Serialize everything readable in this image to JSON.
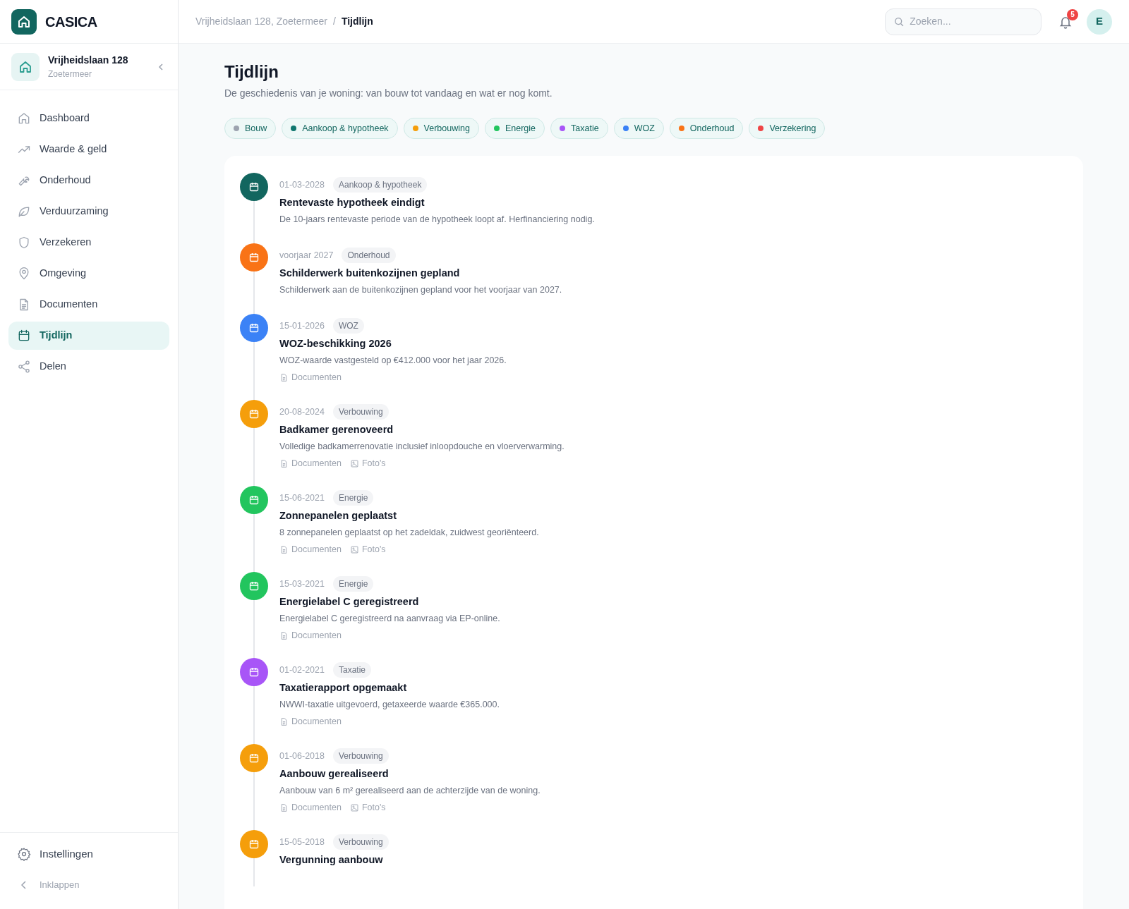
{
  "brand": {
    "name": "CASICA"
  },
  "property": {
    "street": "Vrijheidslaan 128",
    "city": "Zoetermeer"
  },
  "nav": [
    {
      "label": "Dashboard",
      "selected": false
    },
    {
      "label": "Waarde & geld",
      "selected": false
    },
    {
      "label": "Onderhoud",
      "selected": false
    },
    {
      "label": "Verduurzaming",
      "selected": false
    },
    {
      "label": "Verzekeren",
      "selected": false
    },
    {
      "label": "Omgeving",
      "selected": false
    },
    {
      "label": "Documenten",
      "selected": false
    },
    {
      "label": "Tijdlijn",
      "selected": true
    },
    {
      "label": "Delen",
      "selected": false
    }
  ],
  "sidebar_footer": {
    "settings": "Instellingen",
    "collapse": "Inklappen"
  },
  "breadcrumb": [
    "Vrijheidslaan 128, Zoetermeer",
    "Tijdlijn"
  ],
  "breadcrumb_separator": "/",
  "search": {
    "placeholder": "Zoeken..."
  },
  "notifications": {
    "count": "5"
  },
  "avatar": {
    "initial": "E"
  },
  "page": {
    "title": "Tijdlijn",
    "subtitle": "De geschiedenis van je woning: van bouw tot vandaag en wat er nog komt."
  },
  "filters": [
    {
      "label": "Bouw",
      "color": "#9ca3af"
    },
    {
      "label": "Aankoop & hypotheek",
      "color": "#0f766e"
    },
    {
      "label": "Verbouwing",
      "color": "#f59e0b"
    },
    {
      "label": "Energie",
      "color": "#22c55e"
    },
    {
      "label": "Taxatie",
      "color": "#a855f7"
    },
    {
      "label": "WOZ",
      "color": "#3b82f6"
    },
    {
      "label": "Onderhoud",
      "color": "#f97316"
    },
    {
      "label": "Verzekering",
      "color": "#ef4444"
    }
  ],
  "events": [
    {
      "date": "01-03-2028",
      "category": "Aankoop & hypotheek",
      "color": "#12665f",
      "title": "Rentevaste hypotheek eindigt",
      "description": "De 10-jaars rentevaste periode van de hypotheek loopt af. Herfinanciering nodig."
    },
    {
      "date": "voorjaar 2027",
      "category": "Onderhoud",
      "color": "#f97316",
      "title": "Schilderwerk buitenkozijnen gepland",
      "description": "Schilderwerk aan de buitenkozijnen gepland voor het voorjaar van 2027."
    },
    {
      "date": "15-01-2026",
      "category": "WOZ",
      "color": "#3b82f6",
      "title": "WOZ-beschikking 2026",
      "description": "WOZ-waarde vastgesteld op €412.000 voor het jaar 2026.",
      "attachments": [
        {
          "kind": "documents",
          "label": "Documenten"
        }
      ]
    },
    {
      "date": "20-08-2024",
      "category": "Verbouwing",
      "color": "#f59e0b",
      "title": "Badkamer gerenoveerd",
      "description": "Volledige badkamerrenovatie inclusief inloopdouche en vloerverwarming.",
      "attachments": [
        {
          "kind": "documents",
          "label": "Documenten"
        },
        {
          "kind": "photos",
          "label": "Foto's"
        }
      ]
    },
    {
      "date": "15-06-2021",
      "category": "Energie",
      "color": "#22c55e",
      "title": "Zonnepanelen geplaatst",
      "description": "8 zonnepanelen geplaatst op het zadeldak, zuidwest georiënteerd.",
      "attachments": [
        {
          "kind": "documents",
          "label": "Documenten"
        },
        {
          "kind": "photos",
          "label": "Foto's"
        }
      ]
    },
    {
      "date": "15-03-2021",
      "category": "Energie",
      "color": "#22c55e",
      "title": "Energielabel C geregistreerd",
      "description": "Energielabel C geregistreerd na aanvraag via EP-online.",
      "attachments": [
        {
          "kind": "documents",
          "label": "Documenten"
        }
      ]
    },
    {
      "date": "01-02-2021",
      "category": "Taxatie",
      "color": "#a855f7",
      "title": "Taxatierapport opgemaakt",
      "description": "NWWI-taxatie uitgevoerd, getaxeerde waarde €365.000.",
      "attachments": [
        {
          "kind": "documents",
          "label": "Documenten"
        }
      ]
    },
    {
      "date": "01-06-2018",
      "category": "Verbouwing",
      "color": "#f59e0b",
      "title": "Aanbouw gerealiseerd",
      "description": "Aanbouw van 6 m² gerealiseerd aan de achterzijde van de woning.",
      "attachments": [
        {
          "kind": "documents",
          "label": "Documenten"
        },
        {
          "kind": "photos",
          "label": "Foto's"
        }
      ]
    },
    {
      "date": "15-05-2018",
      "category": "Verbouwing",
      "color": "#f59e0b",
      "title": "Vergunning aanbouw"
    }
  ]
}
